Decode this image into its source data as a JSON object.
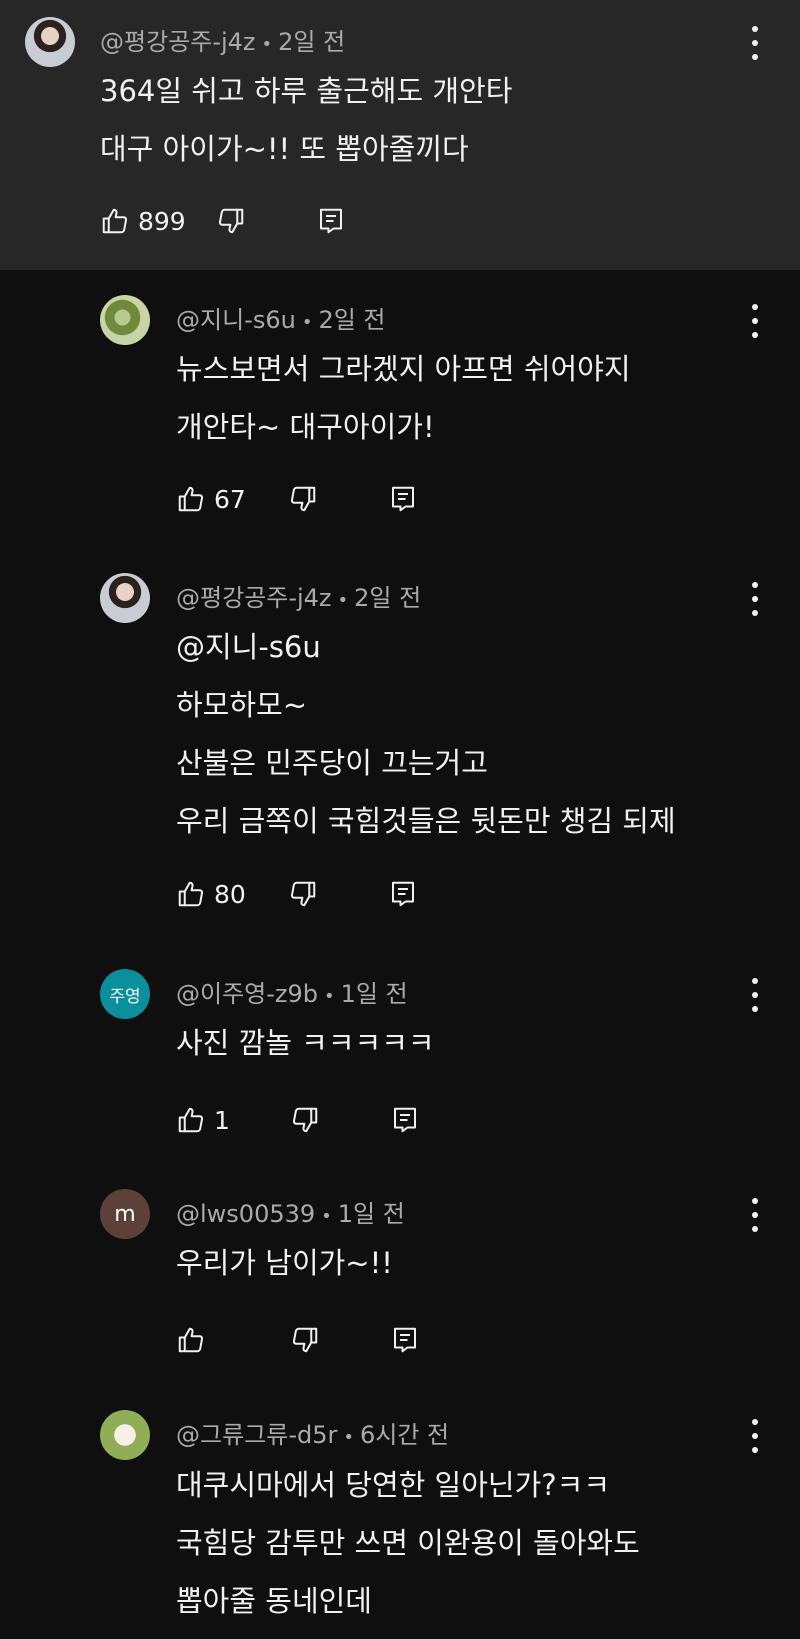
{
  "comments": [
    {
      "author": "@평강공주-j4z",
      "time": "2일 전",
      "lines": [
        "364일 쉬고 하루 출근해도 개안타",
        "대구 아이가~!!  또 뽑아줄끼다"
      ],
      "likes": "899",
      "avatar": "profile-photo"
    },
    {
      "author": "@지니-s6u",
      "time": "2일 전",
      "lines": [
        "뉴스보면서 그라겠지 아프면 쉬어야지",
        "개안타~  대구아이가!"
      ],
      "likes": "67",
      "avatar": "profile-photo"
    },
    {
      "author": "@평강공주-j4z",
      "time": "2일 전",
      "lines": [
        "@지니-s6u",
        "하모하모~",
        "산불은 민주당이 끄는거고",
        "우리 금쪽이 국힘것들은 뒷돈만 챙김 되제"
      ],
      "likes": "80",
      "avatar": "profile-photo"
    },
    {
      "author": "@이주영-z9b",
      "time": "1일 전",
      "lines": [
        "사진 깜놀 ㅋㅋㅋㅋㅋ"
      ],
      "likes": "1",
      "avatar_text": "주영",
      "avatar_color": "#0a8f9c"
    },
    {
      "author": "@lws00539",
      "time": "1일 전",
      "lines": [
        "우리가 남이가~!!"
      ],
      "likes": "",
      "avatar_text": "m",
      "avatar_color": "#5d4037"
    },
    {
      "author": "@그류그류-d5r",
      "time": "6시간 전",
      "lines": [
        "대쿠시마에서 당연한 일아닌가?ㅋㅋ",
        "국힘당 감투만 쓰면 이완용이 돌아와도",
        "뽑아줄 동네인데"
      ],
      "likes": "",
      "avatar": "profile-photo"
    }
  ],
  "colors": {
    "background": "#0f0f0f",
    "highlight": "#272727",
    "meta_text": "#aaaaaa"
  },
  "icons": [
    "thumbs-up-icon",
    "thumbs-down-icon",
    "reply-icon",
    "more-options-icon"
  ]
}
